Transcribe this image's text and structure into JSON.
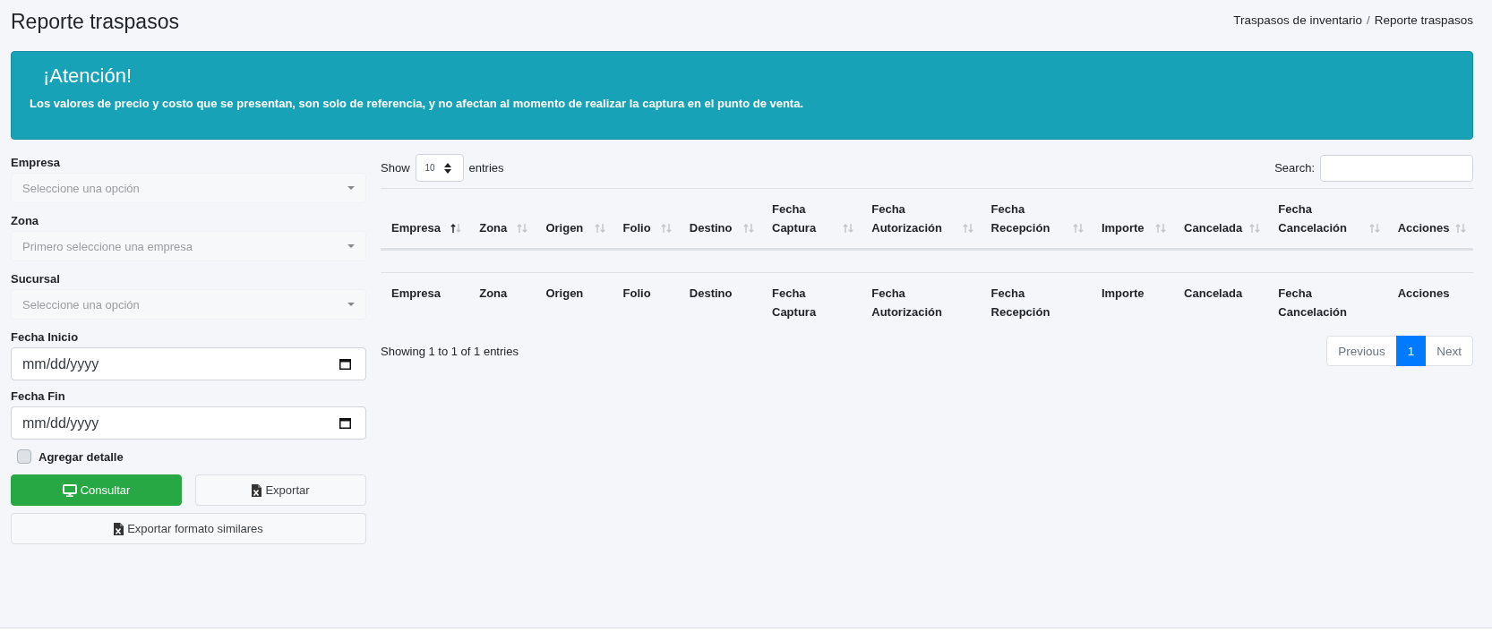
{
  "header": {
    "title": "Reporte traspasos",
    "breadcrumb": {
      "items": [
        "Traspasos de inventario",
        "Reporte traspasos"
      ],
      "separator": "/"
    }
  },
  "alert": {
    "title": "¡Atención!",
    "text": "Los valores de precio y costo que se presentan, son solo de referencia, y no afectan al momento de realizar la captura en el punto de venta."
  },
  "filters": {
    "fields": [
      {
        "kind": "select",
        "label": "Empresa",
        "placeholder": "Seleccione una opción"
      },
      {
        "kind": "select",
        "label": "Zona",
        "placeholder": "Primero seleccione una empresa"
      },
      {
        "kind": "select",
        "label": "Sucursal",
        "placeholder": "Seleccione una opción"
      },
      {
        "kind": "date",
        "label": "Fecha Inicio",
        "placeholder": "mm/dd/yyyy"
      },
      {
        "kind": "date",
        "label": "Fecha Fin",
        "placeholder": "mm/dd/yyyy"
      }
    ],
    "checkbox": {
      "label": "Agregar detalle",
      "checked": false
    },
    "button_rows": [
      [
        {
          "kind": "success",
          "label": "Consultar"
        },
        {
          "kind": "export",
          "label": "Exportar"
        }
      ],
      [
        {
          "kind": "export",
          "label": "Exportar formato similares"
        }
      ]
    ]
  },
  "table": {
    "length_menu": {
      "before": "Show",
      "value": "10",
      "after": "entries"
    },
    "search": {
      "label": "Search:"
    },
    "columns": [
      {
        "label": "Empresa",
        "sorted": true
      },
      {
        "label": "Zona",
        "sorted": false
      },
      {
        "label": "Origen",
        "sorted": false
      },
      {
        "label": "Folio",
        "sorted": false
      },
      {
        "label": "Destino",
        "sorted": false
      },
      {
        "label": "Fecha Captura",
        "sorted": false
      },
      {
        "label": "Fecha Autorización",
        "sorted": false
      },
      {
        "label": "Fecha Recepción",
        "sorted": false
      },
      {
        "label": "Importe",
        "sorted": false
      },
      {
        "label": "Cancelada",
        "sorted": false
      },
      {
        "label": "Fecha Cancelación",
        "sorted": false
      },
      {
        "label": "Acciones",
        "sorted": false
      }
    ],
    "footer": [
      "Empresa",
      "Zona",
      "Origen",
      "Folio",
      "Destino",
      "Fecha Captura",
      "Fecha Autorización",
      "Fecha Recepción",
      "Importe",
      "Cancelada",
      "Fecha Cancelación",
      "Acciones"
    ],
    "info": "Showing 1 to 1 of 1 entries",
    "pagination": [
      {
        "label": "Previous",
        "selected": false,
        "disabled": true
      },
      {
        "label": "1",
        "selected": true,
        "disabled": false
      },
      {
        "label": "Next",
        "selected": false,
        "disabled": true
      }
    ]
  }
}
